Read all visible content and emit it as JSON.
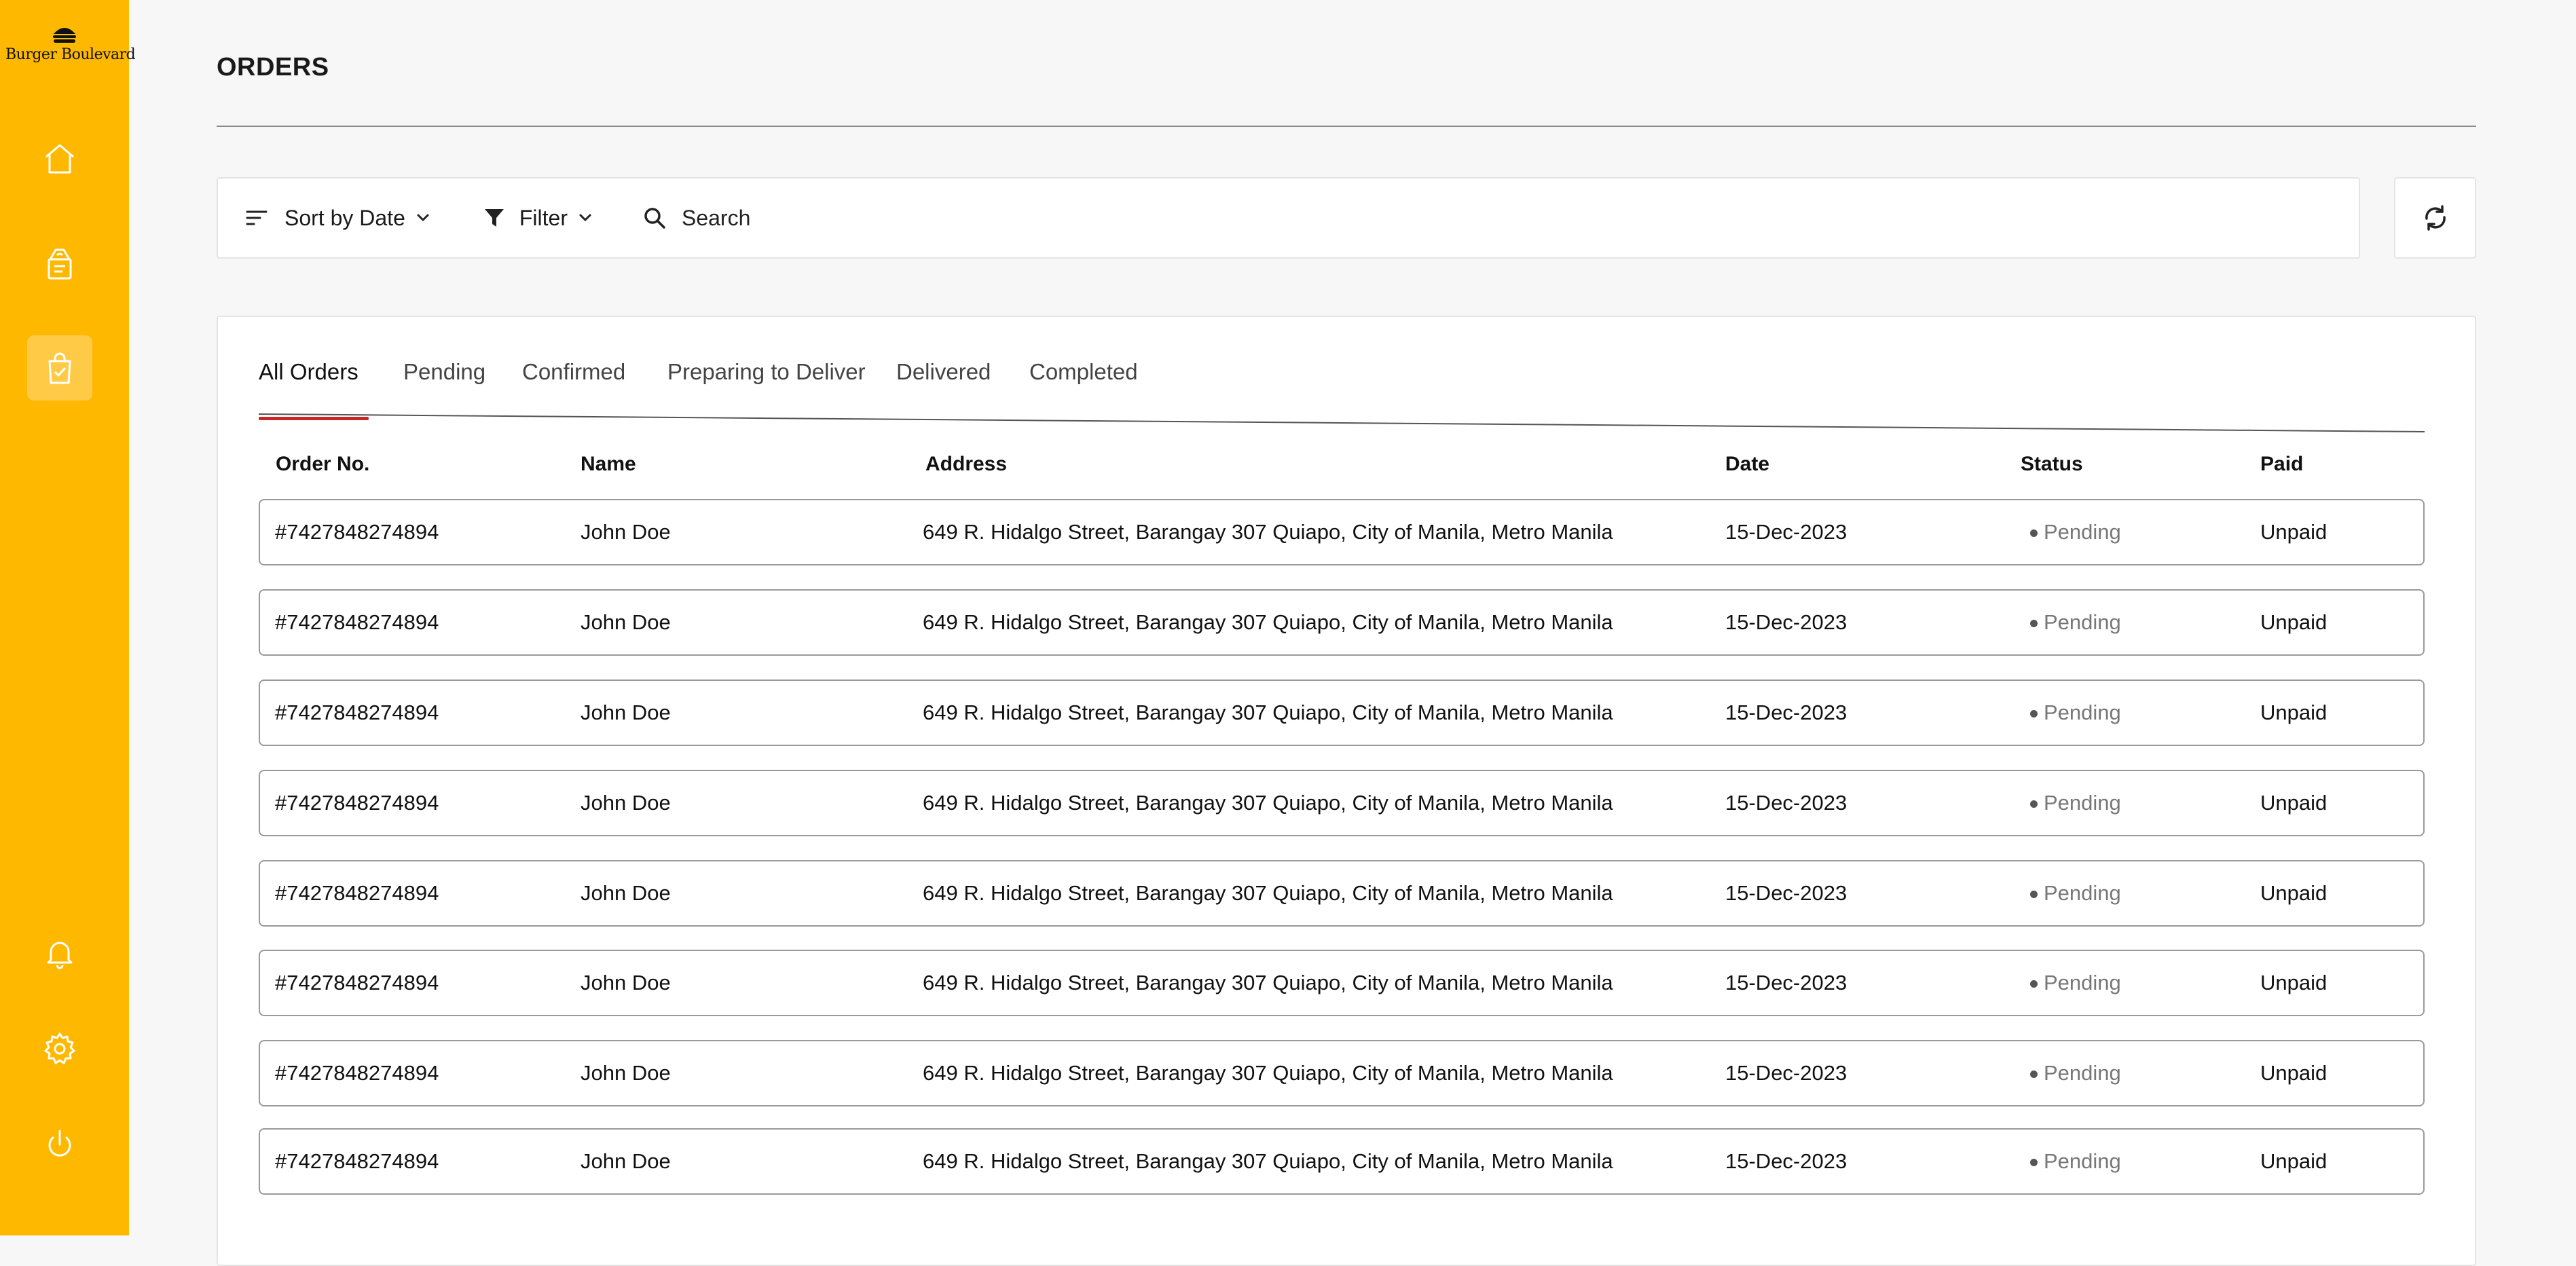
{
  "brand": {
    "name": "Burger Boulevard",
    "accent": "#ffb800"
  },
  "sidebar": {
    "top_items": [
      {
        "icon": "home-icon"
      },
      {
        "icon": "menu-board-icon"
      },
      {
        "icon": "shopping-bag-check-icon",
        "active": true
      }
    ],
    "bottom_items": [
      {
        "icon": "bell-icon"
      },
      {
        "icon": "gear-icon"
      },
      {
        "icon": "power-icon"
      }
    ]
  },
  "page": {
    "title": "ORDERS"
  },
  "toolbar": {
    "sort_label": "Sort by Date",
    "filter_label": "Filter",
    "search_placeholder": "Search"
  },
  "tabs": [
    {
      "label": "All Orders",
      "active": true
    },
    {
      "label": "Pending"
    },
    {
      "label": "Confirmed"
    },
    {
      "label": "Preparing to Deliver"
    },
    {
      "label": "Delivered"
    },
    {
      "label": "Completed"
    }
  ],
  "table": {
    "columns": [
      "Order No.",
      "Name",
      "Address",
      "Date",
      "Status",
      "Paid"
    ],
    "rows": [
      {
        "order_no": "#7427848274894",
        "name": "John Doe",
        "address": "649 R. Hidalgo Street, Barangay 307 Quiapo, City of Manila, Metro Manila",
        "date": "15-Dec-2023",
        "status": "Pending",
        "paid": "Unpaid"
      },
      {
        "order_no": "#7427848274894",
        "name": "John Doe",
        "address": "649 R. Hidalgo Street, Barangay 307 Quiapo, City of Manila, Metro Manila",
        "date": "15-Dec-2023",
        "status": "Pending",
        "paid": "Unpaid"
      },
      {
        "order_no": "#7427848274894",
        "name": "John Doe",
        "address": "649 R. Hidalgo Street, Barangay 307 Quiapo, City of Manila, Metro Manila",
        "date": "15-Dec-2023",
        "status": "Pending",
        "paid": "Unpaid"
      },
      {
        "order_no": "#7427848274894",
        "name": "John Doe",
        "address": "649 R. Hidalgo Street, Barangay 307 Quiapo, City of Manila, Metro Manila",
        "date": "15-Dec-2023",
        "status": "Pending",
        "paid": "Unpaid"
      },
      {
        "order_no": "#7427848274894",
        "name": "John Doe",
        "address": "649 R. Hidalgo Street, Barangay 307 Quiapo, City of Manila, Metro Manila",
        "date": "15-Dec-2023",
        "status": "Pending",
        "paid": "Unpaid"
      },
      {
        "order_no": "#7427848274894",
        "name": "John Doe",
        "address": "649 R. Hidalgo Street, Barangay 307 Quiapo, City of Manila, Metro Manila",
        "date": "15-Dec-2023",
        "status": "Pending",
        "paid": "Unpaid"
      },
      {
        "order_no": "#7427848274894",
        "name": "John Doe",
        "address": "649 R. Hidalgo Street, Barangay 307 Quiapo, City of Manila, Metro Manila",
        "date": "15-Dec-2023",
        "status": "Pending",
        "paid": "Unpaid"
      },
      {
        "order_no": "#7427848274894",
        "name": "John Doe",
        "address": "649 R. Hidalgo Street, Barangay 307 Quiapo, City of Manila, Metro Manila",
        "date": "15-Dec-2023",
        "status": "Pending",
        "paid": "Unpaid"
      }
    ]
  },
  "colors": {
    "tab_underline": "#c62828",
    "status_dot": "#555555"
  }
}
